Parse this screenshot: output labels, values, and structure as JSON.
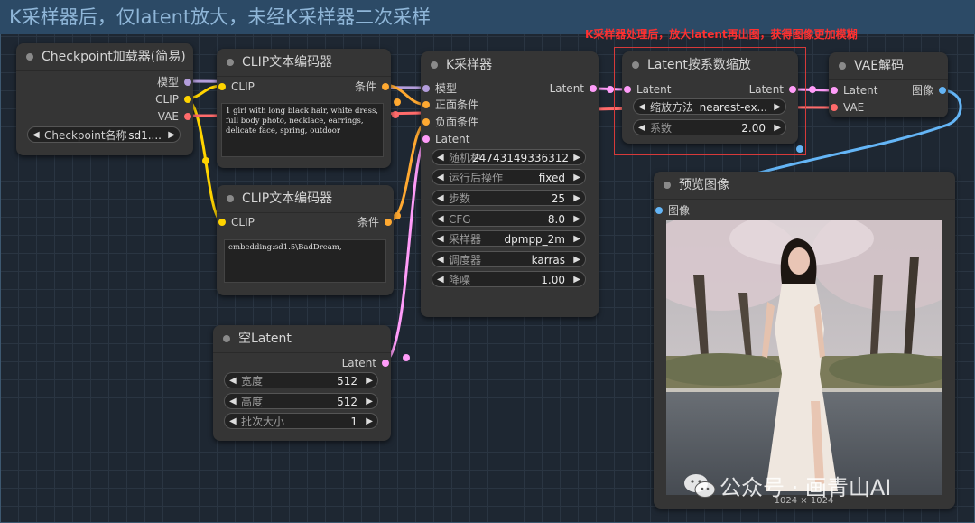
{
  "group": {
    "title": "K采样器后，仅latent放大，未经K采样器二次采样"
  },
  "annotation": "K采样器处理后，放大latent再出图，获得图像更加模糊",
  "colors": {
    "model": "#b39ddb",
    "clip": "#ffd400",
    "vae": "#ff6b6b",
    "cond": "#ffa931",
    "latent": "#ff9cf9",
    "image": "#64b5f6"
  },
  "checkpoint": {
    "title": "Checkpoint加载器(简易)",
    "outputs": [
      "模型",
      "CLIP",
      "VAE"
    ],
    "ckpt_label": "Checkpoint名称",
    "ckpt_value": "sd1...."
  },
  "clip1": {
    "title": "CLIP文本编码器",
    "input": "CLIP",
    "output": "条件",
    "text": "1 girl with long black hair, white dress, full body photo, necklace, earrings, delicate face, spring, outdoor"
  },
  "clip2": {
    "title": "CLIP文本编码器",
    "input": "CLIP",
    "output": "条件",
    "text": "embedding:sd1.5\\BadDream,"
  },
  "empty_latent": {
    "title": "空Latent",
    "output": "Latent",
    "widgets": [
      {
        "label": "宽度",
        "value": "512"
      },
      {
        "label": "高度",
        "value": "512"
      },
      {
        "label": "批次大小",
        "value": "1"
      }
    ]
  },
  "ksampler": {
    "title": "K采样器",
    "inputs": [
      "模型",
      "正面条件",
      "负面条件",
      "Latent"
    ],
    "output": "Latent",
    "widgets": [
      {
        "label": "随机种",
        "value": "247431493363​12"
      },
      {
        "label": "运行后操作",
        "value": "fixed"
      },
      {
        "label": "步数",
        "value": "25"
      },
      {
        "label": "CFG",
        "value": "8.0"
      },
      {
        "label": "采样器",
        "value": "dpmpp_2m"
      },
      {
        "label": "调度器",
        "value": "karras"
      },
      {
        "label": "降噪",
        "value": "1.00"
      }
    ]
  },
  "latent_upscale": {
    "title": "Latent按系数缩放",
    "input": "Latent",
    "output": "Latent",
    "widgets": [
      {
        "label": "缩放方法",
        "value": "nearest-ex..."
      },
      {
        "label": "系数",
        "value": "2.00"
      }
    ]
  },
  "vae_decode": {
    "title": "VAE解码",
    "inputs": [
      "Latent",
      "VAE"
    ],
    "output": "图像"
  },
  "preview": {
    "title": "预览图像",
    "input": "图像",
    "size_label": "1024 × 1024"
  },
  "watermark": "公众号 · 画青山AI"
}
